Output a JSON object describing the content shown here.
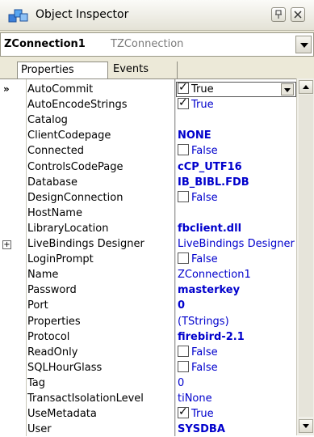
{
  "window": {
    "title": "Object Inspector",
    "pin_glyph": "ᵍ",
    "close_glyph": "☒"
  },
  "selector": {
    "component_name": "ZConnection1",
    "component_type": "TZConnection"
  },
  "tabs": [
    {
      "label": "Properties",
      "active": true
    },
    {
      "label": "Events",
      "active": false
    }
  ],
  "properties": [
    {
      "name": "AutoCommit",
      "kind": "check",
      "checked": true,
      "value": "True",
      "selected": true
    },
    {
      "name": "AutoEncodeStrings",
      "kind": "check",
      "checked": true,
      "value": "True"
    },
    {
      "name": "Catalog",
      "kind": "text",
      "value": ""
    },
    {
      "name": "ClientCodepage",
      "kind": "text",
      "value": "NONE",
      "bold": true
    },
    {
      "name": "Connected",
      "kind": "check",
      "checked": false,
      "value": "False"
    },
    {
      "name": "ControlsCodePage",
      "kind": "text",
      "value": "cCP_UTF16",
      "bold": true
    },
    {
      "name": "Database",
      "kind": "text",
      "value": "IB_BIBL.FDB",
      "bold": true
    },
    {
      "name": "DesignConnection",
      "kind": "check",
      "checked": false,
      "value": "False"
    },
    {
      "name": "HostName",
      "kind": "text",
      "value": ""
    },
    {
      "name": "LibraryLocation",
      "kind": "text",
      "value": "fbclient.dll",
      "bold": true
    },
    {
      "name": "LiveBindings Designer",
      "kind": "text",
      "value": "LiveBindings Designer",
      "expander": true
    },
    {
      "name": "LoginPrompt",
      "kind": "check",
      "checked": false,
      "value": "False"
    },
    {
      "name": "Name",
      "kind": "text",
      "value": "ZConnection1"
    },
    {
      "name": "Password",
      "kind": "text",
      "value": "masterkey",
      "bold": true
    },
    {
      "name": "Port",
      "kind": "text",
      "value": "0",
      "bold": true
    },
    {
      "name": "Properties",
      "kind": "text",
      "value": "(TStrings)"
    },
    {
      "name": "Protocol",
      "kind": "text",
      "value": "firebird-2.1",
      "bold": true
    },
    {
      "name": "ReadOnly",
      "kind": "check",
      "checked": false,
      "value": "False"
    },
    {
      "name": "SQLHourGlass",
      "kind": "check",
      "checked": false,
      "value": "False"
    },
    {
      "name": "Tag",
      "kind": "text",
      "value": "0"
    },
    {
      "name": "TransactIsolationLevel",
      "kind": "text",
      "value": "tiNone"
    },
    {
      "name": "UseMetadata",
      "kind": "check",
      "checked": true,
      "value": "True"
    },
    {
      "name": "User",
      "kind": "text",
      "value": "SYSDBA",
      "bold": true
    }
  ],
  "colors": {
    "value_text": "#0000cc",
    "grid_bg": "#ffffff",
    "chrome_bg": "#ece9d8"
  }
}
